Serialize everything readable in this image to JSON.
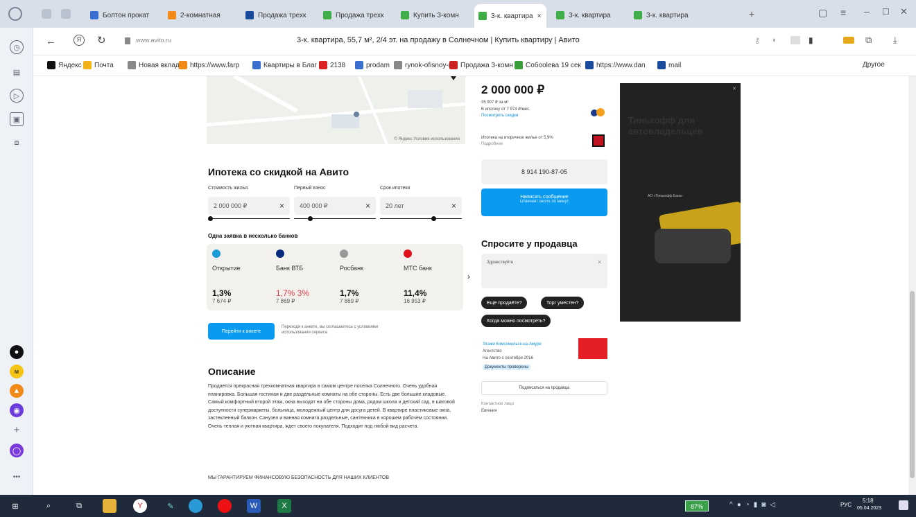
{
  "browser": {
    "tabs": [
      {
        "label": "Болтон прокат",
        "color": "#3a6ecf"
      },
      {
        "label": "2-комнатная",
        "color": "#f28a1a"
      },
      {
        "label": "Продажа трехк",
        "color": "#1a4a9c"
      },
      {
        "label": "Продажа трехк",
        "color": "#3fae49"
      },
      {
        "label": "Купить 3-комн",
        "color": "#3fae49"
      },
      {
        "label": "3-к. квартира",
        "color": "#3fae49",
        "active": true
      },
      {
        "label": "3-к. квартира",
        "color": "#3fae49"
      },
      {
        "label": "3-к. квартира",
        "color": "#3fae49"
      }
    ],
    "url": "www.avito.ru",
    "page_title": "3-к. квартира, 55,7 м², 2/4 эт. на продажу в Солнечном | Купить квартиру | Авито",
    "bookmarks": [
      {
        "label": "Яндекс",
        "color": "#111"
      },
      {
        "label": "Почта",
        "color": "#f2b21a"
      },
      {
        "label": "Новая вкладка",
        "color": "#888"
      },
      {
        "label": "https://www.farp",
        "color": "#f28a1a"
      },
      {
        "label": "Квартиры в Благ",
        "color": "#3a6ecf"
      },
      {
        "label": "2138",
        "color": "#d22"
      },
      {
        "label": "prodam",
        "color": "#3a6ecf"
      },
      {
        "label": "rynok-ofisnoy-nei",
        "color": "#888"
      },
      {
        "label": "Продажа 3-комн",
        "color": "#c22"
      },
      {
        "label": "Собоolева 19 сек",
        "color": "#3a9e3a"
      },
      {
        "label": "https://www.dan",
        "color": "#1a4a9c"
      },
      {
        "label": "mail",
        "color": "#1a4a9c"
      }
    ],
    "bookmarks_other": "Другое"
  },
  "listing": {
    "price": "2 000 000 ₽",
    "price_per_m2": "35 907 ₽ за м²",
    "installment": "В ипотеку от 7 974 ₽/мес.",
    "installment_link": "Посмотреть скидки",
    "mortgage_note_label": "Ипотека на вторичное жилье от 5,9%",
    "mortgage_note_link": "Подробнее",
    "phone": "8 914 190-87-05",
    "write_button": "Написать сообщение",
    "write_sub": "Отвечает около 30 минут",
    "ask_title": "Спросите у продавца",
    "ask_placeholder": "Здравствуйте",
    "chips": [
      "Ещё продаёте?",
      "Торг уместен?",
      "Когда можно посмотреть?"
    ],
    "seller_name": "Этажи Комсомольск-на-Амуре",
    "seller_type": "Агентство",
    "seller_since": "На Авито с сентября 2016",
    "seller_badge": "Документы проверены",
    "seller_subscribe": "Подписаться на продавца",
    "contact_label": "Контактное лицо",
    "contact_name": "Евгения",
    "map_credit": "© Яндекс Условия использования"
  },
  "mortgage": {
    "title": "Ипотека со скидкой на Авито",
    "fields": [
      {
        "label": "Стоимость жилья",
        "value": "2 000 000 ₽"
      },
      {
        "label": "Первый взнос",
        "value": "400 000 ₽"
      },
      {
        "label": "Срок ипотеки",
        "value": "20 лет"
      }
    ],
    "subtitle": "Одна заявка в несколько банков",
    "banks": [
      {
        "name": "Открытие",
        "rate": "1,3%",
        "pay": "7 674 ₽",
        "color": "#1a9ad6"
      },
      {
        "name": "Банк ВТБ",
        "rate": "1,7% 3%",
        "pay": "7 869 ₽",
        "color": "#0a2a80"
      },
      {
        "name": "Росбанк",
        "rate": "1,7%",
        "pay": "7 869 ₽",
        "color": "#999"
      },
      {
        "name": "МТС банк",
        "rate": "11,4%",
        "pay": "16 953 ₽",
        "color": "#e0101a"
      }
    ],
    "apply_button": "Перейти к анкете",
    "apply_note": "Переходя к анкете, вы соглашаетесь с условиями использования сервиса"
  },
  "description": {
    "title": "Описание",
    "text": "Продается прекрасная трехкомнатная квартира в самом центре поселка Солнечного. Очень удобная планировка. Большая гостиная и две раздельные комнаты на обе стороны. Есть две большие кладовые. Самый комфортный второй этаж, окна выходят на обе стороны дома, рядом школа и детский сад, в шаговой доступности супермаркеты, больница, молодежный центр для досуга детей. В квартире пластиковые окна, застекленный балкон. Санузел и ванная комната раздельные, сантехника в хорошем рабочем состоянии. Очень теплая и уютная квартира, ждет своего покупателя. Подходит под любой вид расчета.",
    "guarantee": "МЫ ГАРАНТИРУЕМ ФИНАНСОВУЮ БЕЗОПАСНОСТЬ ДЛЯ НАШИХ КЛИЕНТОВ"
  },
  "ad_banner": {
    "title": "Тинькофф для автовладельцев",
    "sub": "АО «Тинькофф Банк»"
  },
  "taskbar": {
    "battery": "87%",
    "lang": "РУС",
    "time": "5:18",
    "date": "05.04.2023"
  }
}
